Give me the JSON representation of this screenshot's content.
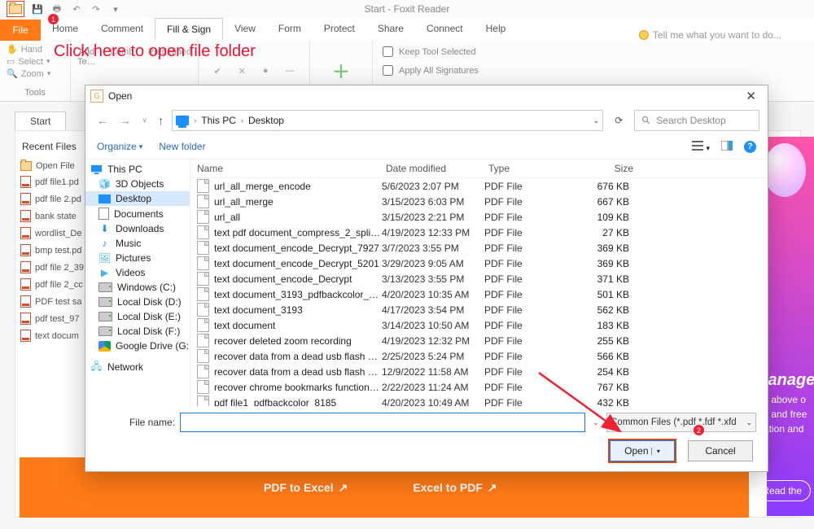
{
  "app": {
    "title": "Start - Foxit Reader"
  },
  "annotation": {
    "text": "Click here to open file folder",
    "badge1": "1",
    "badge2": "2"
  },
  "ribbon": {
    "file": "File",
    "tabs": [
      "Home",
      "Comment",
      "Fill & Sign",
      "View",
      "Form",
      "Protect",
      "Share",
      "Connect",
      "Help"
    ],
    "active_index": 2,
    "tell_me": "Tell me what you want to do...",
    "tools_group": {
      "hand": "Hand",
      "select": "Select",
      "zoom": "Zoom",
      "label": "Tools"
    },
    "fill_group": {
      "add": "Add\nTe…",
      "comb": "Comb",
      "predef": "Predefined"
    },
    "sig_group": {
      "keep": "Keep Tool Selected",
      "apply": "Apply All Signatures"
    }
  },
  "doc_tabs": {
    "start": "Start"
  },
  "recent": {
    "header": "Recent Files",
    "open_file": "Open File",
    "items": [
      "pdf file1.pd",
      "pdf file 2.pd",
      "bank state",
      "wordlist_De",
      "bmp test.pd",
      "pdf file 2_39",
      "pdf file 2_cc",
      "PDF test sa",
      "pdf test_97",
      "text docum"
    ]
  },
  "dialog": {
    "title": "Open",
    "breadcrumb": {
      "root": "This PC",
      "leaf": "Desktop"
    },
    "search_placeholder": "Search Desktop",
    "organize": "Organize",
    "new_folder": "New folder",
    "tree": [
      {
        "label": "This PC",
        "icon": "pc",
        "top": true
      },
      {
        "label": "3D Objects",
        "icon": "cube3"
      },
      {
        "label": "Desktop",
        "icon": "desk",
        "selected": true
      },
      {
        "label": "Documents",
        "icon": "doc"
      },
      {
        "label": "Downloads",
        "icon": "down"
      },
      {
        "label": "Music",
        "icon": "music"
      },
      {
        "label": "Pictures",
        "icon": "pict"
      },
      {
        "label": "Videos",
        "icon": "vid"
      },
      {
        "label": "Windows (C:)",
        "icon": "drive"
      },
      {
        "label": "Local Disk (D:)",
        "icon": "drive"
      },
      {
        "label": "Local Disk (E:)",
        "icon": "drive"
      },
      {
        "label": "Local Disk (F:)",
        "icon": "drive"
      },
      {
        "label": "Google Drive (G:",
        "icon": "gdrive"
      },
      {
        "label": "Network",
        "icon": "net",
        "top": true
      }
    ],
    "columns": {
      "name": "Name",
      "date": "Date modified",
      "type": "Type",
      "size": "Size"
    },
    "files": [
      {
        "name": "url_all_merge_encode",
        "date": "5/6/2023 2:07 PM",
        "type": "PDF File",
        "size": "676 KB"
      },
      {
        "name": "url_all_merge",
        "date": "3/15/2023 6:03 PM",
        "type": "PDF File",
        "size": "667 KB"
      },
      {
        "name": "url_all",
        "date": "3/15/2023 2:21 PM",
        "type": "PDF File",
        "size": "109 KB"
      },
      {
        "name": "text pdf document_compress_2_split_pdf...",
        "date": "4/19/2023 12:33 PM",
        "type": "PDF File",
        "size": "27 KB"
      },
      {
        "name": "text document_encode_Decrypt_7927",
        "date": "3/7/2023 3:55 PM",
        "type": "PDF File",
        "size": "369 KB"
      },
      {
        "name": "text document_encode_Decrypt_5201",
        "date": "3/29/2023 9:05 AM",
        "type": "PDF File",
        "size": "369 KB"
      },
      {
        "name": "text document_encode_Decrypt",
        "date": "3/13/2023 3:55 PM",
        "type": "PDF File",
        "size": "371 KB"
      },
      {
        "name": "text document_3193_pdfbackcolor_7728",
        "date": "4/20/2023 10:35 AM",
        "type": "PDF File",
        "size": "501 KB"
      },
      {
        "name": "text document_3193",
        "date": "4/17/2023 3:54 PM",
        "type": "PDF File",
        "size": "562 KB"
      },
      {
        "name": "text document",
        "date": "3/14/2023 10:50 AM",
        "type": "PDF File",
        "size": "183 KB"
      },
      {
        "name": "recover deleted zoom recording",
        "date": "4/19/2023 12:32 PM",
        "type": "PDF File",
        "size": "255 KB"
      },
      {
        "name": "recover data from a dead usb flash drive ...",
        "date": "2/25/2023 5:24 PM",
        "type": "PDF File",
        "size": "566 KB"
      },
      {
        "name": "recover data from a dead usb flash drive ...",
        "date": "12/9/2022 11:58 AM",
        "type": "PDF File",
        "size": "254 KB"
      },
      {
        "name": "recover chrome bookmarks functional p...",
        "date": "2/22/2023 11:24 AM",
        "type": "PDF File",
        "size": "767 KB"
      },
      {
        "name": "pdf file1_pdfbackcolor_8185",
        "date": "4/20/2023 10:49 AM",
        "type": "PDF File",
        "size": "432 KB"
      }
    ],
    "file_name_label": "File name:",
    "file_name_value": "",
    "filetype": "Common Files (*.pdf *.fdf *.xfd",
    "open_btn": "Open",
    "cancel_btn": "Cancel"
  },
  "orange": {
    "p2e": "PDF to Excel",
    "e2p": "Excel to PDF"
  },
  "promo": {
    "title_frag": "lanage",
    "line1": "y above o",
    "line2": "y and free",
    "line3": "ation and",
    "cta": "Read the"
  }
}
